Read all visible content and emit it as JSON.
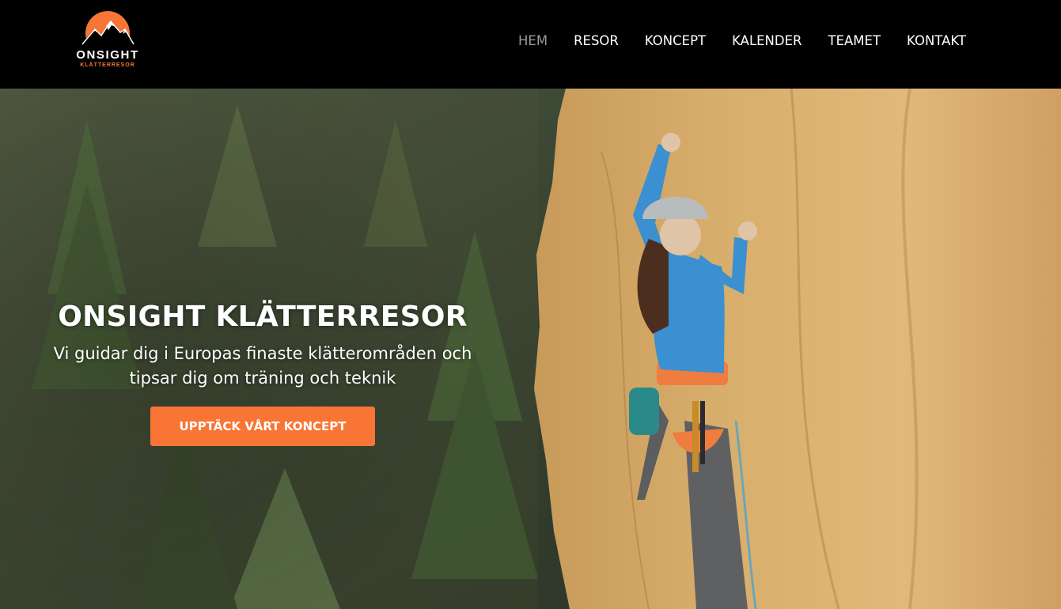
{
  "brand": {
    "name": "ONSIGHT",
    "tagline": "KLÄTTERRESOR",
    "accent_color": "#f87536",
    "logo_icon": "sun-mountain-logo"
  },
  "nav": {
    "items": [
      {
        "label": "HEM",
        "active": true
      },
      {
        "label": "RESOR",
        "active": false
      },
      {
        "label": "KONCEPT",
        "active": false
      },
      {
        "label": "KALENDER",
        "active": false
      },
      {
        "label": "TEAMET",
        "active": false
      },
      {
        "label": "KONTAKT",
        "active": false
      }
    ]
  },
  "hero": {
    "title": "ONSIGHT KLÄTTERRESOR",
    "subtitle_line1": "Vi guidar dig i Europas finaste klätterområden och",
    "subtitle_line2": "tipsar dig om träning och teknik",
    "cta_label": "UPPTÄCK VÅRT KONCEPT",
    "image": "climber-on-rock-wall-photo"
  }
}
